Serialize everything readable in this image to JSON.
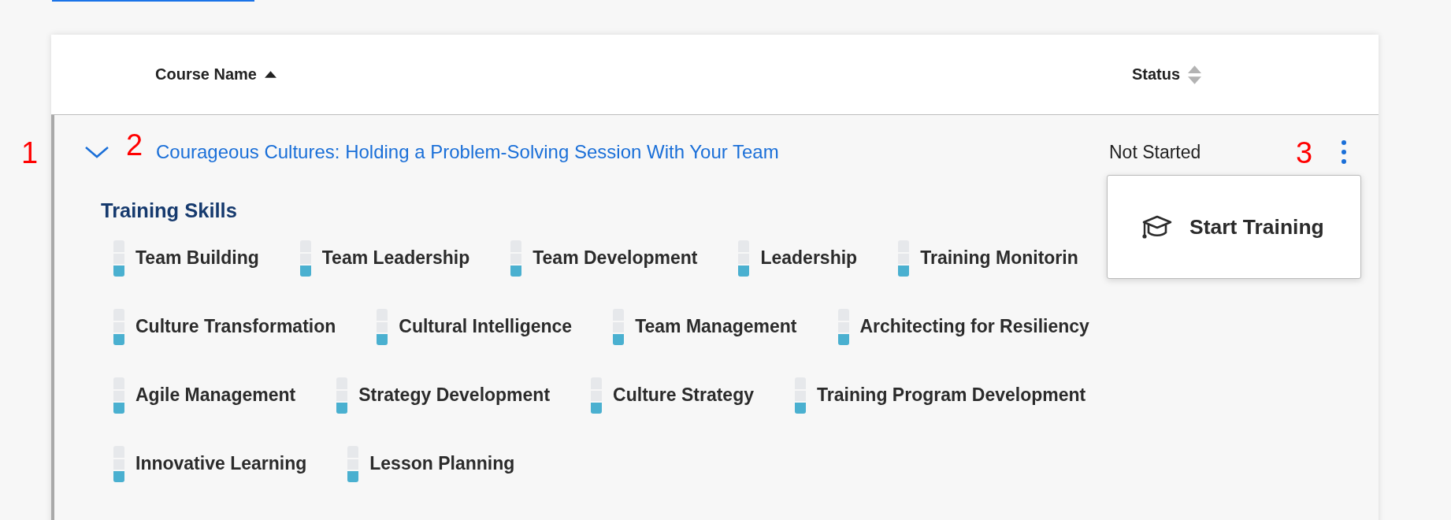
{
  "table": {
    "columns": [
      {
        "label": "Course Name",
        "sorted": true
      },
      {
        "label": "Status",
        "sorted": false
      }
    ],
    "rows": [
      {
        "expanded": true,
        "title": "Courageous Cultures: Holding a Problem-Solving Session With Your Team",
        "status": "Not Started",
        "skills_title": "Training Skills",
        "skill_rows": [
          [
            {
              "name": "Team Building",
              "level": 0.33
            },
            {
              "name": "Team Leadership",
              "level": 0.33
            },
            {
              "name": "Team Development",
              "level": 0.33
            },
            {
              "name": "Leadership",
              "level": 0.33
            },
            {
              "name": "Training Monitorin",
              "level": 0.33
            }
          ],
          [
            {
              "name": "Culture Transformation",
              "level": 0.33
            },
            {
              "name": "Cultural Intelligence",
              "level": 0.33
            },
            {
              "name": "Team Management",
              "level": 0.33
            },
            {
              "name": "Architecting for Resiliency",
              "level": 0.33
            }
          ],
          [
            {
              "name": "Agile Management",
              "level": 0.33
            },
            {
              "name": "Strategy Development",
              "level": 0.33
            },
            {
              "name": "Culture Strategy",
              "level": 0.33
            },
            {
              "name": "Training Program Development",
              "level": 0.33
            }
          ],
          [
            {
              "name": "Innovative Learning",
              "level": 0.33
            },
            {
              "name": "Lesson Planning",
              "level": 0.33
            }
          ]
        ],
        "menu": {
          "open": true,
          "items": [
            "Start Training"
          ]
        }
      }
    ]
  },
  "annotations": [
    "1",
    "2",
    "3"
  ]
}
